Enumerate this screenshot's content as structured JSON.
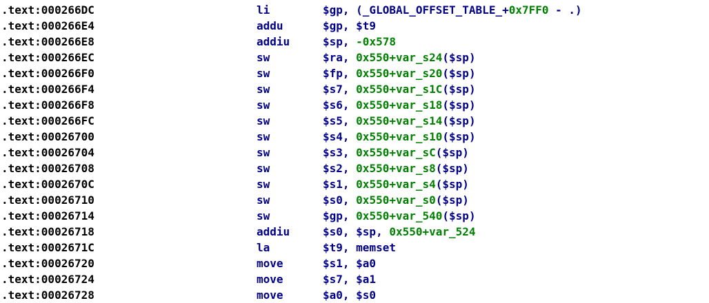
{
  "colors": {
    "background": "#ffffff",
    "address": "#000000",
    "mnemonic": "#00008b",
    "register": "#00008b",
    "constant": "#008000",
    "stack_var": "#008000",
    "function_name": "#00008b",
    "symbol": "#00008b"
  },
  "rows": [
    {
      "address": ".text:000266DC",
      "mnemonic": "li",
      "operands": [
        {
          "text": "$gp, (_GLOBAL_OFFSET_TABLE_+",
          "kind": "reg"
        },
        {
          "text": "0x7FF0",
          "kind": "num"
        },
        {
          "text": " - .)",
          "kind": "reg"
        }
      ]
    },
    {
      "address": ".text:000266E4",
      "mnemonic": "addu",
      "operands": [
        {
          "text": "$gp, $t9",
          "kind": "reg"
        }
      ]
    },
    {
      "address": ".text:000266E8",
      "mnemonic": "addiu",
      "operands": [
        {
          "text": "$sp, ",
          "kind": "reg"
        },
        {
          "text": "-0x578",
          "kind": "num"
        }
      ]
    },
    {
      "address": ".text:000266EC",
      "mnemonic": "sw",
      "operands": [
        {
          "text": "$ra, ",
          "kind": "reg"
        },
        {
          "text": "0x550+var_s24",
          "kind": "num"
        },
        {
          "text": "($sp)",
          "kind": "reg"
        }
      ]
    },
    {
      "address": ".text:000266F0",
      "mnemonic": "sw",
      "operands": [
        {
          "text": "$fp, ",
          "kind": "reg"
        },
        {
          "text": "0x550+var_s20",
          "kind": "num"
        },
        {
          "text": "($sp)",
          "kind": "reg"
        }
      ]
    },
    {
      "address": ".text:000266F4",
      "mnemonic": "sw",
      "operands": [
        {
          "text": "$s7, ",
          "kind": "reg"
        },
        {
          "text": "0x550+var_s1C",
          "kind": "num"
        },
        {
          "text": "($sp)",
          "kind": "reg"
        }
      ]
    },
    {
      "address": ".text:000266F8",
      "mnemonic": "sw",
      "operands": [
        {
          "text": "$s6, ",
          "kind": "reg"
        },
        {
          "text": "0x550+var_s18",
          "kind": "num"
        },
        {
          "text": "($sp)",
          "kind": "reg"
        }
      ]
    },
    {
      "address": ".text:000266FC",
      "mnemonic": "sw",
      "operands": [
        {
          "text": "$s5, ",
          "kind": "reg"
        },
        {
          "text": "0x550+var_s14",
          "kind": "num"
        },
        {
          "text": "($sp)",
          "kind": "reg"
        }
      ]
    },
    {
      "address": ".text:00026700",
      "mnemonic": "sw",
      "operands": [
        {
          "text": "$s4, ",
          "kind": "reg"
        },
        {
          "text": "0x550+var_s10",
          "kind": "num"
        },
        {
          "text": "($sp)",
          "kind": "reg"
        }
      ]
    },
    {
      "address": ".text:00026704",
      "mnemonic": "sw",
      "operands": [
        {
          "text": "$s3, ",
          "kind": "reg"
        },
        {
          "text": "0x550+var_sC",
          "kind": "num"
        },
        {
          "text": "($sp)",
          "kind": "reg"
        }
      ]
    },
    {
      "address": ".text:00026708",
      "mnemonic": "sw",
      "operands": [
        {
          "text": "$s2, ",
          "kind": "reg"
        },
        {
          "text": "0x550+var_s8",
          "kind": "num"
        },
        {
          "text": "($sp)",
          "kind": "reg"
        }
      ]
    },
    {
      "address": ".text:0002670C",
      "mnemonic": "sw",
      "operands": [
        {
          "text": "$s1, ",
          "kind": "reg"
        },
        {
          "text": "0x550+var_s4",
          "kind": "num"
        },
        {
          "text": "($sp)",
          "kind": "reg"
        }
      ]
    },
    {
      "address": ".text:00026710",
      "mnemonic": "sw",
      "operands": [
        {
          "text": "$s0, ",
          "kind": "reg"
        },
        {
          "text": "0x550+var_s0",
          "kind": "num"
        },
        {
          "text": "($sp)",
          "kind": "reg"
        }
      ]
    },
    {
      "address": ".text:00026714",
      "mnemonic": "sw",
      "operands": [
        {
          "text": "$gp, ",
          "kind": "reg"
        },
        {
          "text": "0x550+var_540",
          "kind": "num"
        },
        {
          "text": "($sp)",
          "kind": "reg"
        }
      ]
    },
    {
      "address": ".text:00026718",
      "mnemonic": "addiu",
      "operands": [
        {
          "text": "$s0, $sp, ",
          "kind": "reg"
        },
        {
          "text": "0x550+var_524",
          "kind": "num"
        }
      ]
    },
    {
      "address": ".text:0002671C",
      "mnemonic": "la",
      "operands": [
        {
          "text": "$t9, ",
          "kind": "reg"
        },
        {
          "text": "memset",
          "kind": "func"
        }
      ]
    },
    {
      "address": ".text:00026720",
      "mnemonic": "move",
      "operands": [
        {
          "text": "$s1, $a0",
          "kind": "reg"
        }
      ]
    },
    {
      "address": ".text:00026724",
      "mnemonic": "move",
      "operands": [
        {
          "text": "$s7, $a1",
          "kind": "reg"
        }
      ]
    },
    {
      "address": ".text:00026728",
      "mnemonic": "move",
      "operands": [
        {
          "text": "$a0, $s0",
          "kind": "reg"
        }
      ]
    }
  ]
}
